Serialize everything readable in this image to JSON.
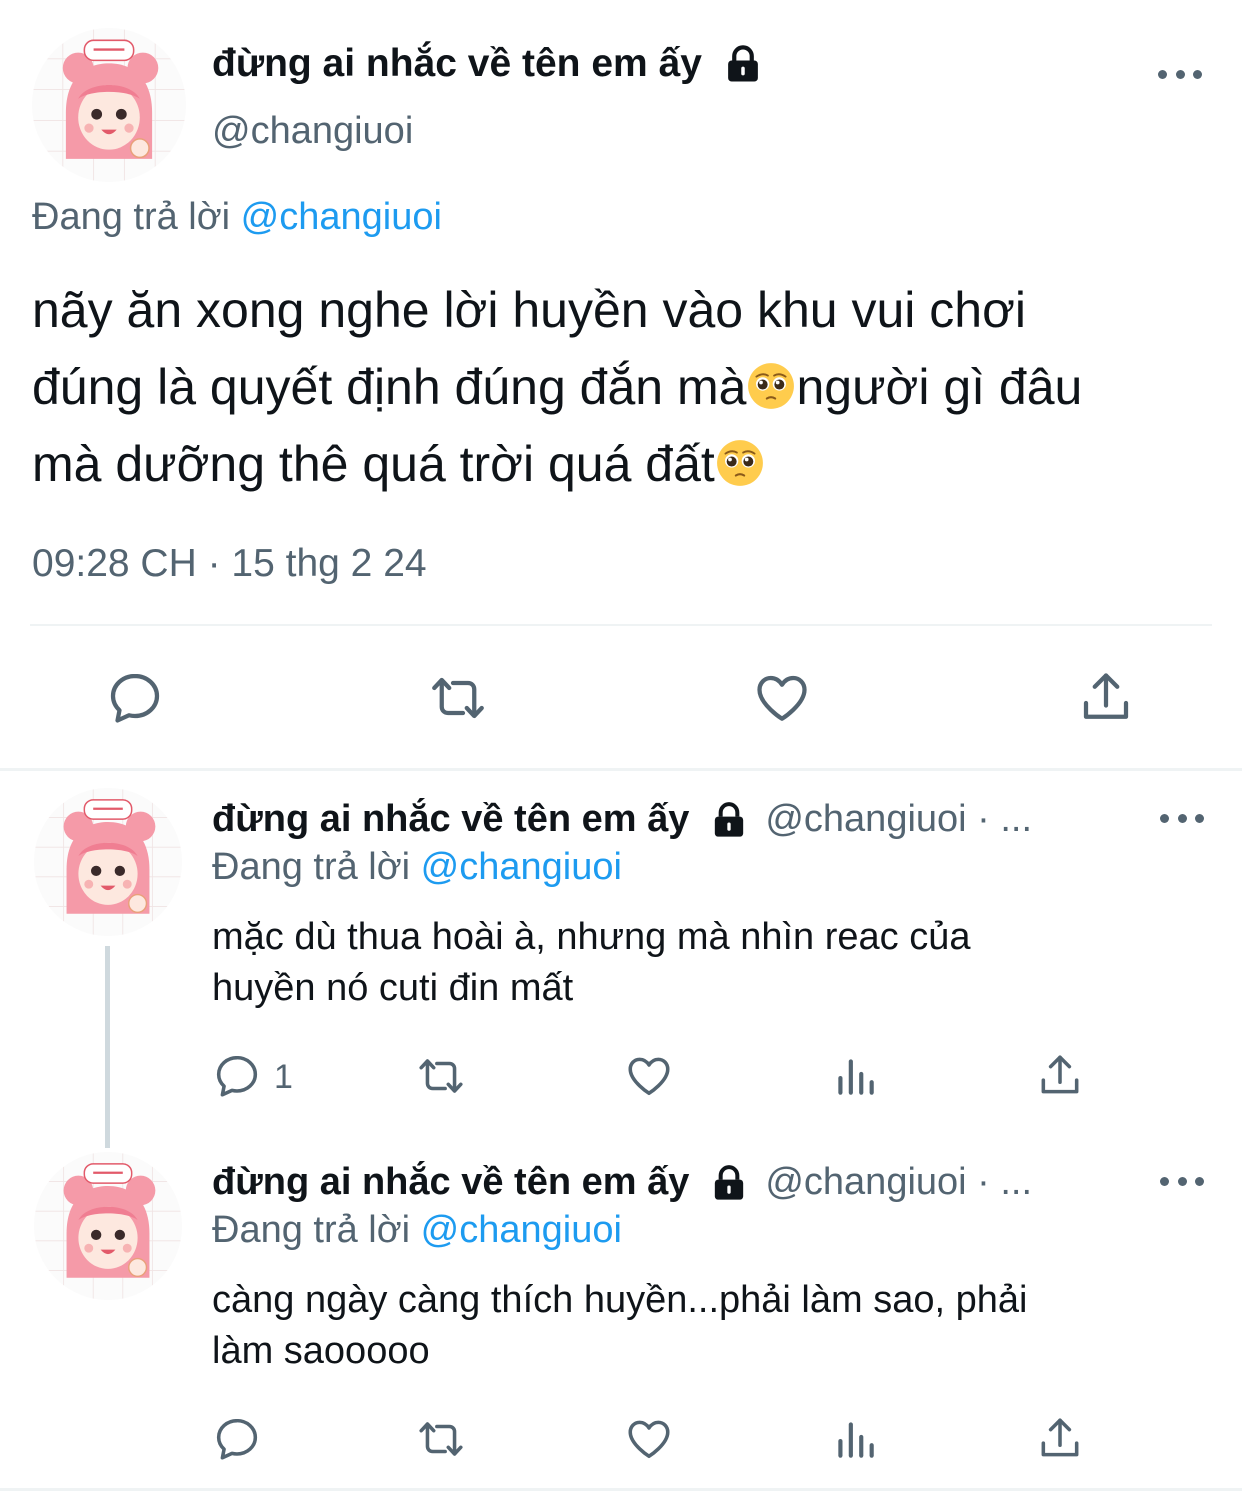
{
  "main_tweet": {
    "display_name": "đừng ai nhắc về tên em ấy",
    "handle": "@changiuoi",
    "replying_prefix": "Đang trả lời",
    "replying_to": "@changiuoi",
    "text_line1": "nãy ăn xong nghe lời huyền vào khu vui chơi",
    "text_line2a": "đúng là quyết định đúng đắn mà",
    "text_line2b": "người gì đâu",
    "text_line3": "mà dưỡng thê quá trời quá đất",
    "timestamp": "09:28 CH · 15 thg 2 24",
    "actions": [
      "reply-icon",
      "retweet-icon",
      "like-icon",
      "share-icon"
    ]
  },
  "replies": [
    {
      "display_name": "đừng ai nhắc về tên em ấy",
      "handle": "@changiuoi · ...",
      "replying_prefix": "Đang trả lời",
      "replying_to": "@changiuoi",
      "text": "mặc dù thua hoài à, nhưng mà nhìn reac của\nhuyền nó cuti đin mất",
      "reply_count": "1",
      "actions": [
        "reply-icon",
        "retweet-icon",
        "like-icon",
        "views-icon",
        "share-icon"
      ]
    },
    {
      "display_name": "đừng ai nhắc về tên em ấy",
      "handle": "@changiuoi · ...",
      "replying_prefix": "Đang trả lời",
      "replying_to": "@changiuoi",
      "text": "càng ngày càng thích huyền...phải làm sao, phải\nlàm saooooo",
      "reply_count": "",
      "actions": [
        "reply-icon",
        "retweet-icon",
        "like-icon",
        "views-icon",
        "share-icon"
      ]
    }
  ],
  "colors": {
    "text": "#0f1419",
    "secondary": "#536471",
    "link": "#1d9bf0",
    "divider": "#eff3f4"
  }
}
